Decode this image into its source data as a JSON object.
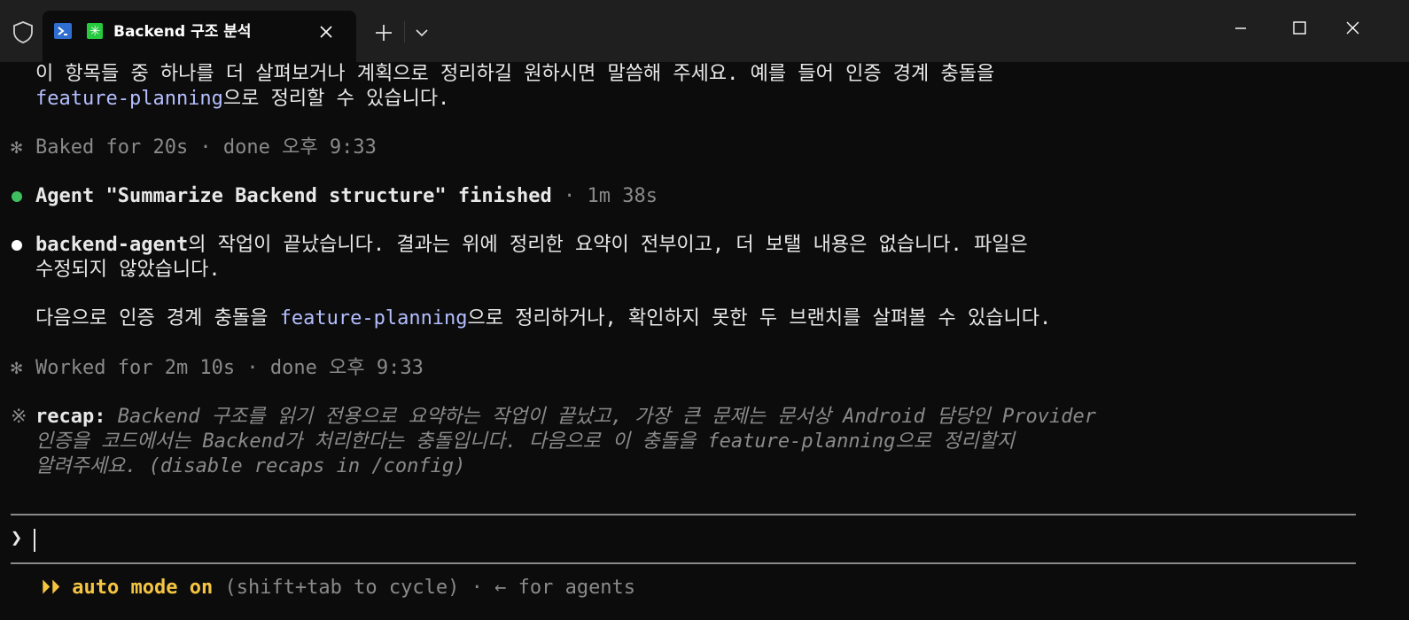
{
  "window": {
    "tab_title": "Backend 구조 분석",
    "tab_status_glyph": "✳"
  },
  "conversation": {
    "intro_line1": "이 항목들 중 하나를 더 살펴보거나 계획으로 정리하길 원하시면 말씀해 주세요. 예를 들어 인증 경계 충돌을",
    "intro_line2_link": "feature-planning",
    "intro_line2_rest": "으로 정리할 수 있습니다.",
    "baked_status": "Baked for 20s · done 오후 9:33",
    "agent_finished_name": "Agent \"Summarize Backend structure\" finished",
    "agent_finished_time": " · 1m 38s",
    "result_agent": "backend-agent",
    "result_line1_rest": "의 작업이 끝났습니다. 결과는 위에 정리한 요약이 전부이고, 더 보탤 내용은 없습니다. 파일은",
    "result_line2": "수정되지 않았습니다.",
    "next_pre": "다음으로 인증 경계 충돌을 ",
    "next_link": "feature-planning",
    "next_rest": "으로 정리하거나, 확인하지 못한 두 브랜치를 살펴볼 수 있습니다.",
    "worked_status": "Worked for 2m 10s · done 오후 9:33",
    "recap_label": "recap:",
    "recap_line1": " Backend 구조를 읽기 전용으로 요약하는 작업이 끝났고, 가장 큰 문제는 문서상 Android 담당인 Provider",
    "recap_line2": "인증을 코드에서는 Backend가 처리한다는 충돌입니다. 다음으로 이 충돌을 feature-planning으로 정리할지",
    "recap_line3": "알려주세요. (disable recaps in /config)"
  },
  "marks": {
    "spinner_glyph": "✻",
    "recap_glyph": "※",
    "prompt_glyph": "❯"
  },
  "status_bar": {
    "mode_glyph": "⏵⏵",
    "mode_label": "auto mode on",
    "hint": " (shift+tab to cycle) · ← for agents"
  },
  "colors": {
    "background": "#0c0c0c",
    "titlebar": "#1f1f1f",
    "link": "#b4befe",
    "muted": "#8a8a8a",
    "success_dot": "#3fbf5f",
    "accent_yellow": "#f5c542"
  },
  "icons": {
    "shield": "shield-icon",
    "powershell": "powershell-icon",
    "close": "close-icon",
    "new_tab": "plus-icon",
    "dropdown": "chevron-down-icon",
    "minimize": "minimize-icon",
    "maximize": "maximize-icon",
    "window_close": "window-close-icon"
  }
}
